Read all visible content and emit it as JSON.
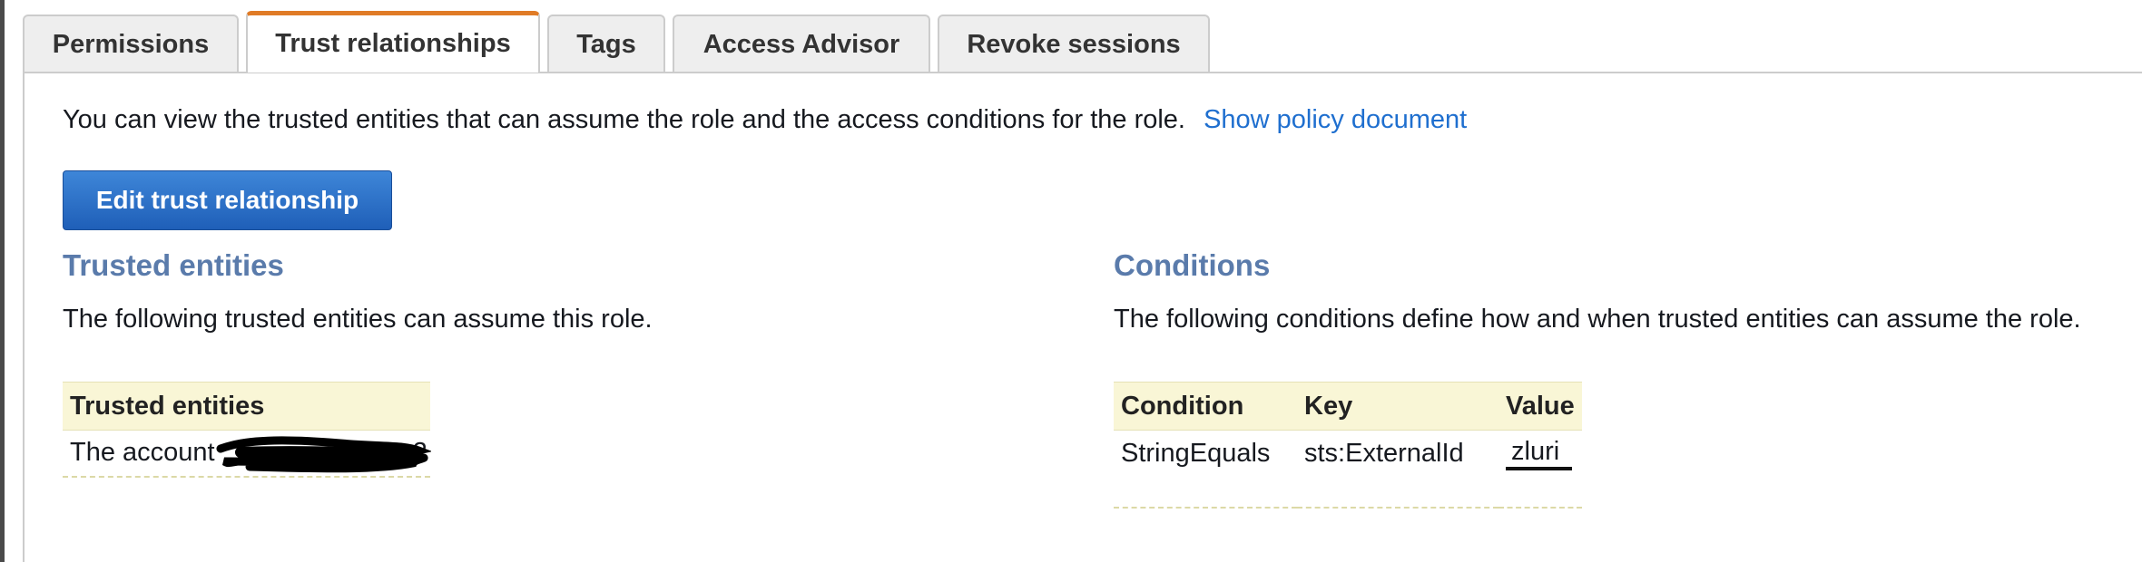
{
  "tabs": [
    {
      "label": "Permissions",
      "active": false
    },
    {
      "label": "Trust relationships",
      "active": true
    },
    {
      "label": "Tags",
      "active": false
    },
    {
      "label": "Access Advisor",
      "active": false
    },
    {
      "label": "Revoke sessions",
      "active": false
    }
  ],
  "intro": {
    "text": "You can view the trusted entities that can assume the role and the access conditions for the role.",
    "link_label": "Show policy document"
  },
  "edit_button_label": "Edit trust relationship",
  "trusted": {
    "title": "Trusted entities",
    "description": "The following trusted entities can assume this role.",
    "column_header": "Trusted entities",
    "rows": [
      {
        "prefix": "The account",
        "suffix": "2",
        "redacted": true
      }
    ]
  },
  "conditions": {
    "title": "Conditions",
    "description": "The following conditions define how and when trusted entities can assume the role.",
    "headers": [
      "Condition",
      "Key",
      "Value"
    ],
    "rows": [
      {
        "condition": "StringEquals",
        "key": "sts:ExternalId",
        "value": "zluri"
      }
    ]
  },
  "colors": {
    "accent_tab": "#e07b26",
    "button_blue": "#1f5fb8",
    "link": "#1f6fcf",
    "section_title": "#5a7bab",
    "table_header_bg": "#f9f6d6"
  }
}
